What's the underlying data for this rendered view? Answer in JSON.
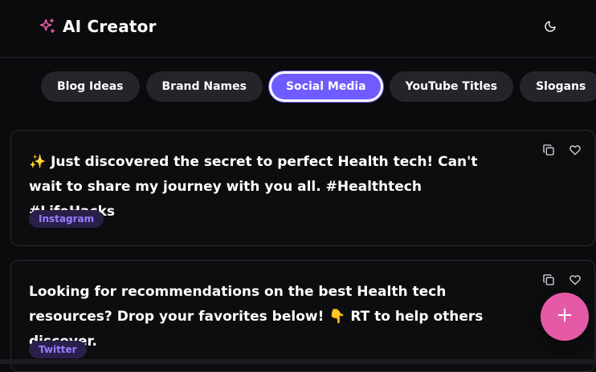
{
  "header": {
    "title": "AI Creator",
    "logo_icon": "sparkles-icon",
    "theme_icon": "moon-icon"
  },
  "tabs": [
    {
      "label": "Blog Ideas",
      "active": false
    },
    {
      "label": "Brand Names",
      "active": false
    },
    {
      "label": "Social Media",
      "active": true
    },
    {
      "label": "YouTube Titles",
      "active": false
    },
    {
      "label": "Slogans",
      "active": false
    }
  ],
  "cards": [
    {
      "text": "✨ Just discovered the secret to perfect Health tech! Can't wait to share my journey with you all. #Healthtech #LifeHacks",
      "platform": "Instagram"
    },
    {
      "text": "Looking for recommendations on the best Health tech resources? Drop your favorites below! 👇 RT to help others discover.",
      "platform": "Twitter"
    }
  ],
  "card_actions": [
    "copy-icon",
    "heart-icon"
  ],
  "fab": {
    "icon": "plus-icon"
  },
  "colors": {
    "background": "#0b0b0e",
    "accent": "#6e5cff",
    "fab": "#e55aa7",
    "logo": "#e55aa7",
    "badge_bg": "#2a1f4a",
    "badge_text": "#9a7cff"
  }
}
